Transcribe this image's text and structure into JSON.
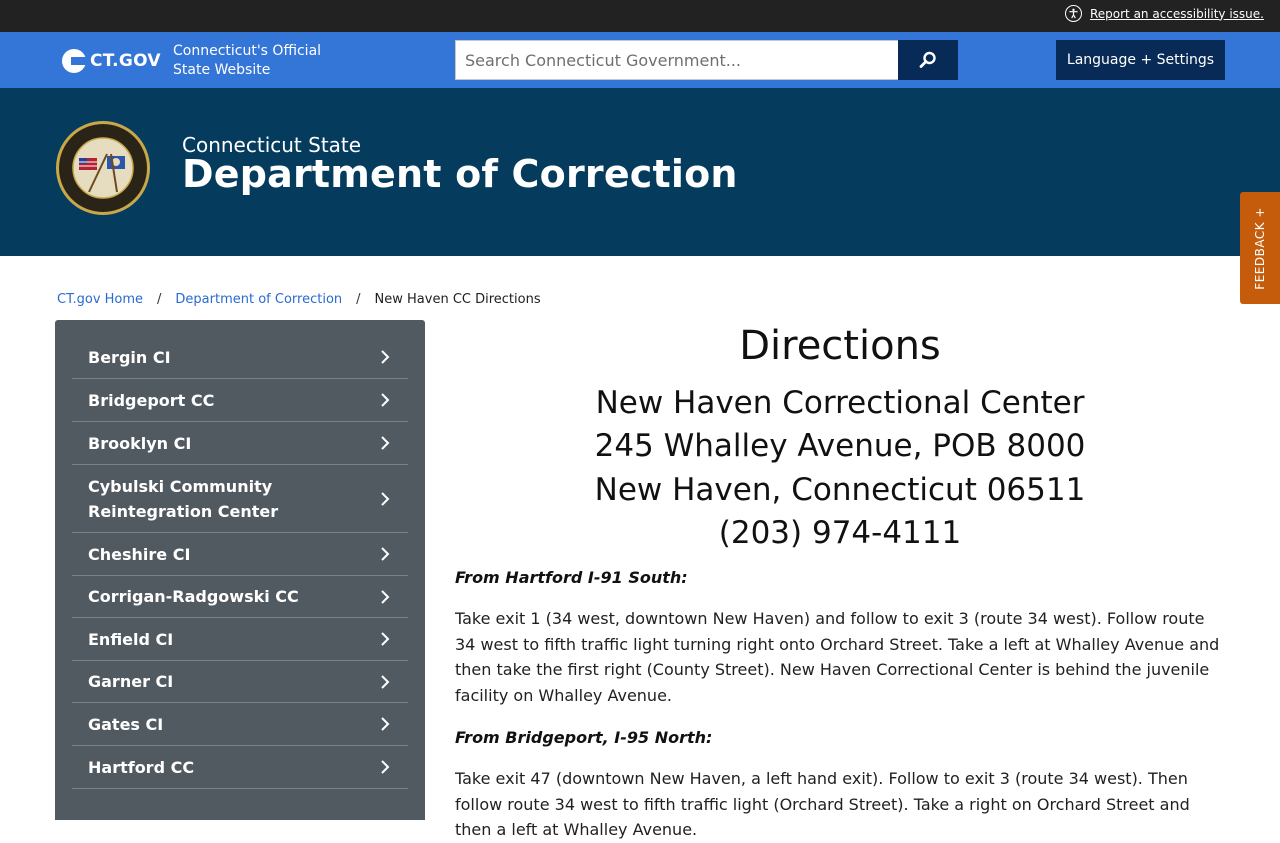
{
  "topbar": {
    "accessibility_link": "Report an accessibility issue."
  },
  "govbar": {
    "logo_text": "CT.GOV",
    "tagline_line1": "Connecticut's Official",
    "tagline_line2": "State Website",
    "search_placeholder": "Search Connecticut Government...",
    "language_button": "Language + Settings"
  },
  "banner": {
    "pre_title": "Connecticut State",
    "title": "Department of Correction"
  },
  "feedback": {
    "label": "FEEDBACK"
  },
  "breadcrumb": {
    "items": [
      "CT.gov Home",
      "Department of Correction"
    ],
    "current": "New Haven CC Directions",
    "separator": "/"
  },
  "sidebar": {
    "items": [
      {
        "label": "Bergin CI"
      },
      {
        "label": "Bridgeport CC"
      },
      {
        "label": "Brooklyn CI"
      },
      {
        "label": "Cybulski Community Reintegration Center"
      },
      {
        "label": "Cheshire CI"
      },
      {
        "label": "Corrigan-Radgowski CC"
      },
      {
        "label": "Enfield CI"
      },
      {
        "label": "Garner CI"
      },
      {
        "label": "Gates CI"
      },
      {
        "label": "Hartford CC"
      }
    ]
  },
  "main": {
    "title": "Directions",
    "address": {
      "line1": "New Haven Correctional Center",
      "line2": "245 Whalley Avenue, POB 8000",
      "line3": "New Haven, Connecticut 06511",
      "phone": "(203) 974-4111"
    },
    "sections": [
      {
        "heading": "From Hartford I-91 South:",
        "text": "Take exit 1 (34 west, downtown New Haven) and follow to exit 3 (route 34 west). Follow route 34 west to fifth traffic light turning right onto Orchard Street. Take a left at Whalley Avenue and then take the first right (County Street). New Haven Correctional Center is behind the juvenile facility on Whalley Avenue."
      },
      {
        "heading": "From Bridgeport, I-95 North:",
        "text": "Take exit 47 (downtown New Haven, a left hand exit). Follow to exit 3 (route 34 west). Then follow route 34 west to fifth traffic light (Orchard Street). Take a right on Orchard Street and then a left at Whalley Avenue."
      }
    ]
  },
  "colors": {
    "topbar": "#222222",
    "govbar": "#3475d8",
    "button_dark": "#082a56",
    "banner": "#053c5e",
    "sidebar": "#525a61",
    "feedback": "#c45c0b",
    "link": "#2a6ad1"
  },
  "icons": {
    "accessibility": "accessibility-icon",
    "search": "search-icon",
    "chevron": "chevron-right-icon",
    "seal": "department-seal-icon",
    "feedback_plus": "plus-icon"
  }
}
